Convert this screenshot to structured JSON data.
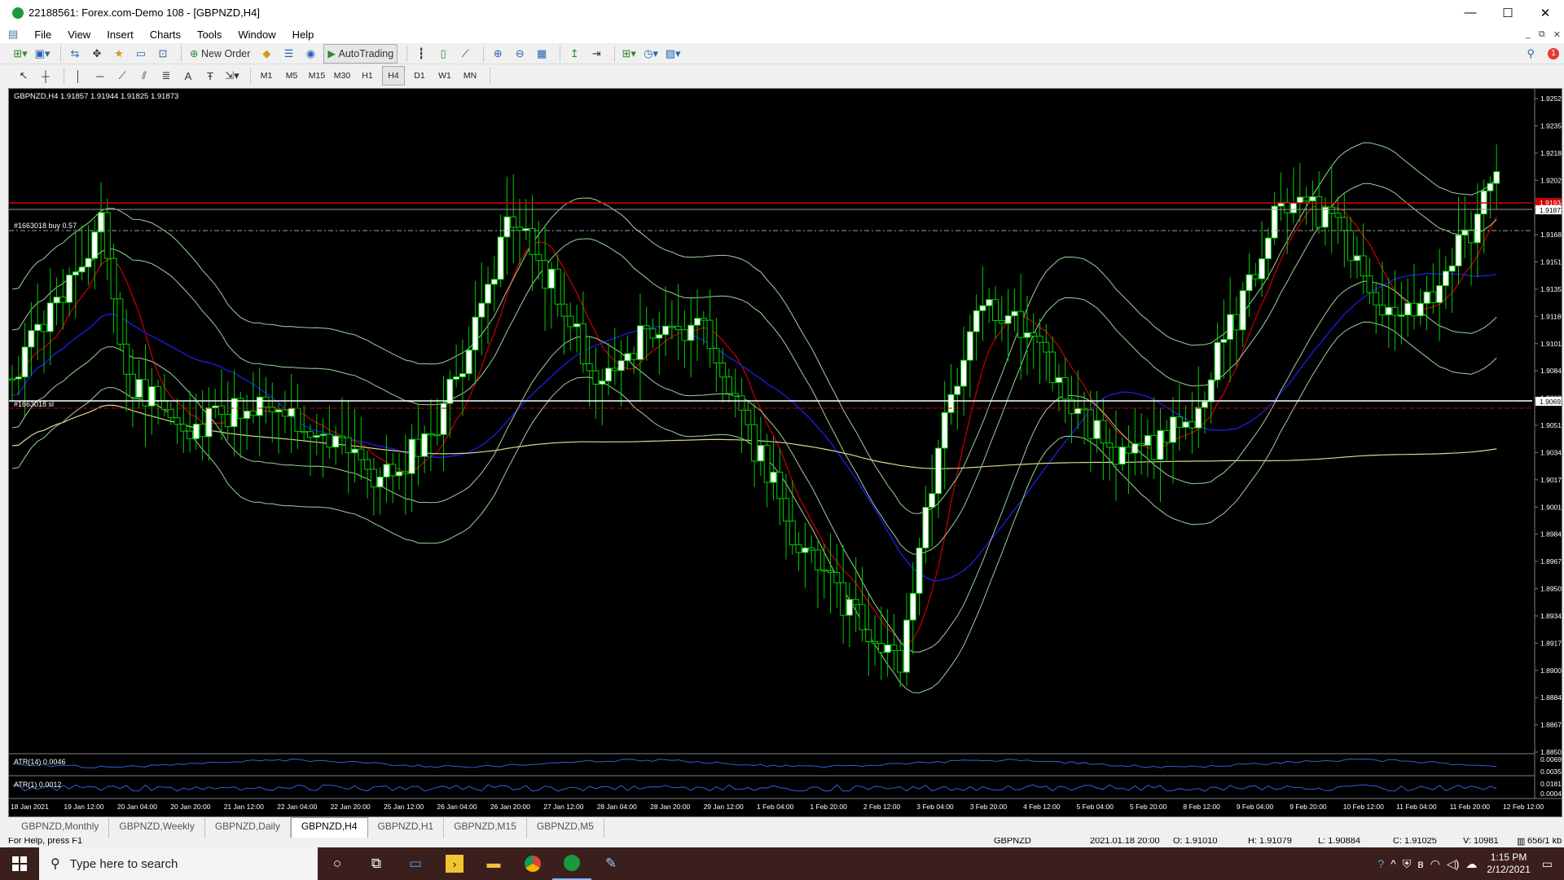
{
  "window": {
    "title": "22188561: Forex.com-Demo 108 - [GBPNZD,H4]",
    "minimize": "—",
    "maximize": "☐",
    "close": "✕"
  },
  "menu": [
    "File",
    "View",
    "Insert",
    "Charts",
    "Tools",
    "Window",
    "Help"
  ],
  "toolbar": {
    "new_order": "New Order",
    "autotrading": "AutoTrading"
  },
  "timeframes": [
    "M1",
    "M5",
    "M15",
    "M30",
    "H1",
    "H4",
    "D1",
    "W1",
    "MN"
  ],
  "active_timeframe": "H4",
  "chart": {
    "header": "GBPNZD,H4  1.91857 1.91944 1.91825 1.91873",
    "order_buy_label": "#1663018 buy 0.57",
    "order_sl_label": "#1663018 sl",
    "bid_price": "1.91873",
    "sl_price": "1.90692",
    "price_red_tag": "1.91934",
    "price_scale": [
      "1.92520",
      "1.92355",
      "1.92185",
      "1.92020",
      "1.91850",
      "1.91685",
      "1.91515",
      "1.91350",
      "1.91180",
      "1.91015",
      "1.90845",
      "1.90680",
      "1.90510",
      "1.90345",
      "1.90175",
      "1.90010",
      "1.89840",
      "1.89675",
      "1.89505",
      "1.89340",
      "1.89170",
      "1.89005",
      "1.88840",
      "1.88670",
      "1.88505"
    ],
    "time_scale": [
      "18 Jan 2021",
      "19 Jan 12:00",
      "20 Jan 04:00",
      "20 Jan 20:00",
      "21 Jan 12:00",
      "22 Jan 04:00",
      "22 Jan 20:00",
      "25 Jan 12:00",
      "26 Jan 04:00",
      "26 Jan 20:00",
      "27 Jan 12:00",
      "28 Jan 04:00",
      "28 Jan 20:00",
      "29 Jan 12:00",
      "1 Feb 04:00",
      "1 Feb 20:00",
      "2 Feb 12:00",
      "3 Feb 04:00",
      "3 Feb 20:00",
      "4 Feb 12:00",
      "5 Feb 04:00",
      "5 Feb 20:00",
      "8 Feb 12:00",
      "9 Feb 04:00",
      "9 Feb 20:00",
      "10 Feb 12:00",
      "11 Feb 04:00",
      "11 Feb 20:00",
      "12 Feb 12:00"
    ],
    "atr14_label": "ATR(14) 0.0046",
    "atr14_scale": [
      "0.0069",
      "0.0035"
    ],
    "atr1_label": "ATR(1) 0.0012",
    "atr1_scale": [
      "0.0181",
      "0.0004"
    ],
    "colors": {
      "background": "#000000",
      "bull_candle": "#ffffff",
      "wick": "#00cc00",
      "ma_fast": "#cc0000",
      "ma_mid": "#1c1cd8",
      "ma_slow": "#d8d890",
      "bollinger": "#9ad39a",
      "order_line": "#888888",
      "sl_line": "#ffffff",
      "red_level": "#d00000"
    }
  },
  "tabs": [
    "GBPNZD,Monthly",
    "GBPNZD,Weekly",
    "GBPNZD,Daily",
    "GBPNZD,H4",
    "GBPNZD,H1",
    "GBPNZD,M15",
    "GBPNZD,M5"
  ],
  "active_tab": "GBPNZD,H4",
  "status": {
    "help": "For Help, press F1",
    "symbol": "GBPNZD",
    "datetime": "2021.01.18 20:00",
    "open": "O: 1.91010",
    "high": "H: 1.91079",
    "low": "L: 1.90884",
    "close": "C: 1.91025",
    "volume": "V: 10981",
    "traffic": "656/1 kb"
  },
  "taskbar": {
    "search_placeholder": "Type here to search",
    "time": "1:15 PM",
    "date": "2/12/2021"
  }
}
